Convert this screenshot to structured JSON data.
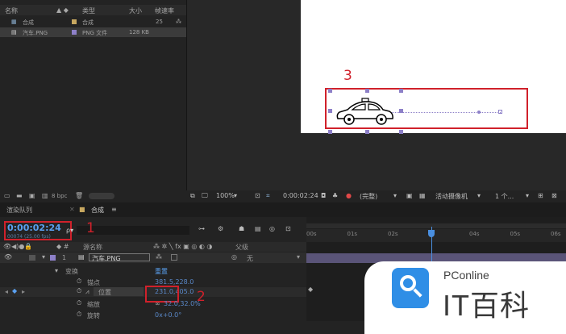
{
  "project": {
    "columns": {
      "name": "名称",
      "type": "类型",
      "size": "大小",
      "fps": "帧速率"
    },
    "items": [
      {
        "name": "合成",
        "type": "合成",
        "size": "",
        "fps": "25",
        "color": "#c8a860"
      },
      {
        "name": "汽车.PNG",
        "type": "PNG 文件",
        "size": "128 KB",
        "fps": "",
        "color": "#8d80c8"
      }
    ],
    "bpc": "8 bpc"
  },
  "viewer": {
    "zoom": "100%",
    "time": "0:00:02:24",
    "quality": "(完整)",
    "camera": "活动摄像机",
    "views": "1 个..."
  },
  "timeline": {
    "tabs": {
      "render_queue": "渲染队列",
      "comp": "合成"
    },
    "timecode": "0:00:02:24",
    "frames": "00074 (25.00 fps)",
    "search_placeholder": "ρ▾",
    "columns": {
      "source": "源名称",
      "parent": "父级"
    },
    "layer": {
      "index": "1",
      "name": "汽车.PNG",
      "parent": "无"
    },
    "transform": "变换",
    "reset": "重置",
    "properties": [
      {
        "name": "锚点",
        "value": "381.5,228.0"
      },
      {
        "name": "位置",
        "value": "231.0,405.0"
      },
      {
        "name": "缩放",
        "value": "32.0,32.0%"
      },
      {
        "name": "旋转",
        "value": "0x+0.0°"
      }
    ],
    "ruler": [
      "00s",
      "01s",
      "02s",
      "04s",
      "05s",
      "06s"
    ],
    "playhead_seconds": 2.96
  },
  "annotations": [
    "1",
    "2",
    "3"
  ],
  "watermark": {
    "brand": "PConline",
    "text": "IT百科"
  }
}
